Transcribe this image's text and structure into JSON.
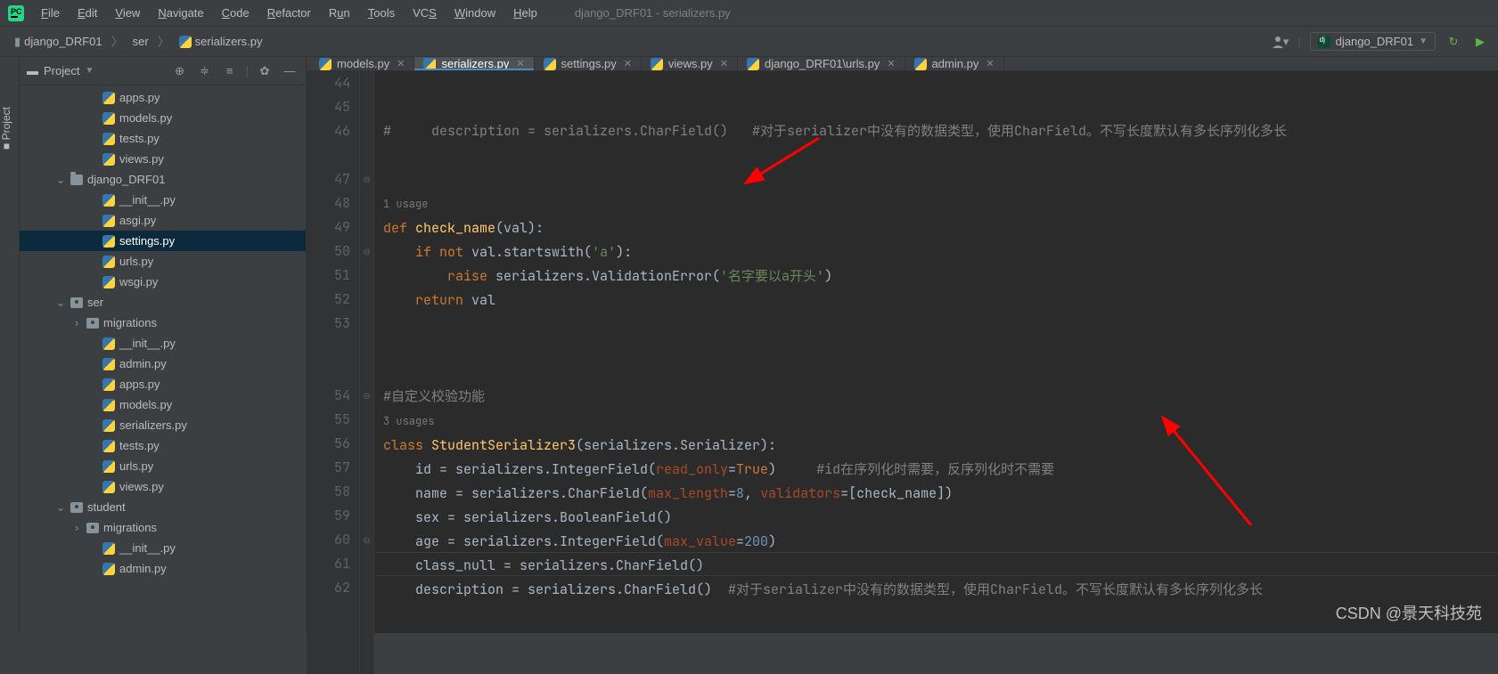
{
  "menubar": {
    "items": [
      "File",
      "Edit",
      "View",
      "Navigate",
      "Code",
      "Refactor",
      "Run",
      "Tools",
      "VCS",
      "Window",
      "Help"
    ],
    "underlines": [
      "F",
      "E",
      "V",
      "N",
      "C",
      "R",
      "u",
      "T",
      "S",
      "W",
      "H"
    ],
    "title": "django_DRF01 - serializers.py"
  },
  "breadcrumbs": {
    "p0": "django_DRF01",
    "p1": "ser",
    "p2": "serializers.py"
  },
  "run_config": "django_DRF01",
  "project_panel": {
    "title": "Project"
  },
  "tree": [
    {
      "d": 3,
      "type": "py",
      "name": "apps.py",
      "chev": ""
    },
    {
      "d": 3,
      "type": "py",
      "name": "models.py",
      "chev": ""
    },
    {
      "d": 3,
      "type": "py",
      "name": "tests.py",
      "chev": ""
    },
    {
      "d": 3,
      "type": "py",
      "name": "views.py",
      "chev": ""
    },
    {
      "d": 1,
      "type": "dir",
      "name": "django_DRF01",
      "chev": "v"
    },
    {
      "d": 3,
      "type": "py",
      "name": "__init__.py",
      "chev": ""
    },
    {
      "d": 3,
      "type": "py",
      "name": "asgi.py",
      "chev": ""
    },
    {
      "d": 3,
      "type": "py",
      "name": "settings.py",
      "chev": "",
      "sel": true
    },
    {
      "d": 3,
      "type": "py",
      "name": "urls.py",
      "chev": ""
    },
    {
      "d": 3,
      "type": "py",
      "name": "wsgi.py",
      "chev": ""
    },
    {
      "d": 1,
      "type": "pkg",
      "name": "ser",
      "chev": "v"
    },
    {
      "d": 2,
      "type": "pkg",
      "name": "migrations",
      "chev": ">"
    },
    {
      "d": 3,
      "type": "py",
      "name": "__init__.py",
      "chev": ""
    },
    {
      "d": 3,
      "type": "py",
      "name": "admin.py",
      "chev": ""
    },
    {
      "d": 3,
      "type": "py",
      "name": "apps.py",
      "chev": ""
    },
    {
      "d": 3,
      "type": "py",
      "name": "models.py",
      "chev": ""
    },
    {
      "d": 3,
      "type": "py",
      "name": "serializers.py",
      "chev": ""
    },
    {
      "d": 3,
      "type": "py",
      "name": "tests.py",
      "chev": ""
    },
    {
      "d": 3,
      "type": "py",
      "name": "urls.py",
      "chev": ""
    },
    {
      "d": 3,
      "type": "py",
      "name": "views.py",
      "chev": ""
    },
    {
      "d": 1,
      "type": "pkg",
      "name": "student",
      "chev": "v"
    },
    {
      "d": 2,
      "type": "pkg",
      "name": "migrations",
      "chev": ">"
    },
    {
      "d": 3,
      "type": "py",
      "name": "__init__.py",
      "chev": ""
    },
    {
      "d": 3,
      "type": "py",
      "name": "admin.py",
      "chev": ""
    }
  ],
  "tabs": [
    {
      "label": "models.py",
      "active": false
    },
    {
      "label": "serializers.py",
      "active": true
    },
    {
      "label": "settings.py",
      "active": false
    },
    {
      "label": "views.py",
      "active": false
    },
    {
      "label": "django_DRF01\\urls.py",
      "active": false
    },
    {
      "label": "admin.py",
      "active": false
    }
  ],
  "gutter": [
    "44",
    "45",
    "46",
    "",
    "47",
    "48",
    "49",
    "50",
    "51",
    "52",
    "53",
    "",
    "",
    "54",
    "55",
    "56",
    "57",
    "58",
    "59",
    "60",
    "61",
    "62"
  ],
  "fold": [
    "",
    "",
    "",
    "",
    "⊖",
    "",
    "",
    "⊖",
    "",
    "",
    "",
    "",
    "",
    "⊖",
    "",
    "",
    "",
    "",
    "",
    "⊖",
    "",
    ""
  ],
  "code": {
    "l44_a": "#     description = serializers.CharField()   ",
    "l44_b": "#对于serializer中没有的数据类型，使用CharField。不写长度默认有多长序列化多长",
    "usage1": "1 usage",
    "l47_def": "def ",
    "l47_fn": "check_name",
    "l47_rest": "(val):",
    "l48_if": "if ",
    "l48_not": "not ",
    "l48_rest": "val.startswith(",
    "l48_str": "'a'",
    "l48_end": "):",
    "l49_raise": "raise ",
    "l49_rest": "serializers.ValidationError(",
    "l49_str": "'名字要以a开头'",
    "l49_end": ")",
    "l50_ret": "return ",
    "l50_v": "val",
    "l53": "#自定义校验功能",
    "usage2": "3 usages",
    "l54_a": "class ",
    "l54_b": "StudentSerializer3",
    "l54_c": "(serializers.Serializer):",
    "l55_a": "    id = serializers.IntegerField(",
    "l55_p": "read_only",
    "l55_b": "=",
    "l55_v": "True",
    "l55_c": ")     ",
    "l55_cmt": "#id在序列化时需要，反序列化时不需要",
    "l56_a": "    name = serializers.CharField(",
    "l56_p1": "max_length",
    "l56_b": "=",
    "l56_n": "8",
    "l56_c": ", ",
    "l56_p2": "validators",
    "l56_d": "=[check_name])",
    "l57": "    sex = serializers.BooleanField()",
    "l58_a": "    age = serializers.IntegerField(",
    "l58_p": "max_value",
    "l58_b": "=",
    "l58_n": "200",
    "l58_c": ")",
    "l59": "    class_null = serializers.CharField()",
    "l60_a": "    description = serializers.CharField()  ",
    "l60_cmt": "#对于serializer中没有的数据类型，使用CharField。不写长度默认有多长序列化多长"
  },
  "watermark": "CSDN @景天科技苑"
}
